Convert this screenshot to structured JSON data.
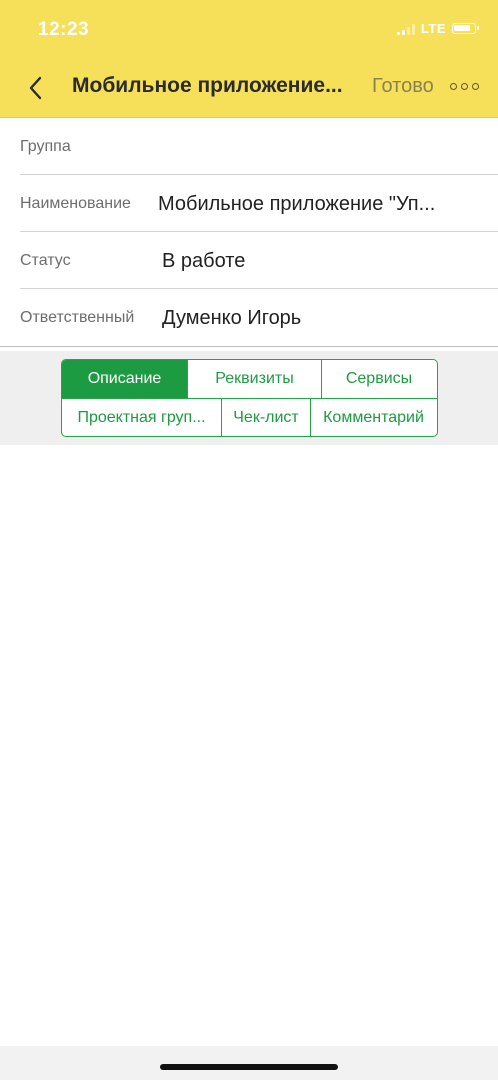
{
  "status_bar": {
    "time": "12:23",
    "network": "LTE",
    "battery_level": 0.85
  },
  "nav": {
    "title": "Мобильное приложение...",
    "done_label": "Готово",
    "back_icon": "chevron-left-icon",
    "more_icon": "more-dots-icon"
  },
  "form": {
    "rows": [
      {
        "label": "Группа",
        "value": ""
      },
      {
        "label": "Наименование",
        "value": "Мобильное приложение \"Уп..."
      },
      {
        "label": "Статус",
        "value": "В работе"
      },
      {
        "label": "Ответственный",
        "value": "Думенко Игорь"
      }
    ]
  },
  "tabs": {
    "row1": [
      "Описание",
      "Реквизиты",
      "Сервисы"
    ],
    "row2": [
      "Проектная груп...",
      "Чек-лист",
      "Комментарий"
    ],
    "active": "Описание"
  },
  "colors": {
    "header_bg": "#f6e05a",
    "accent_green": "#1c9b43"
  }
}
